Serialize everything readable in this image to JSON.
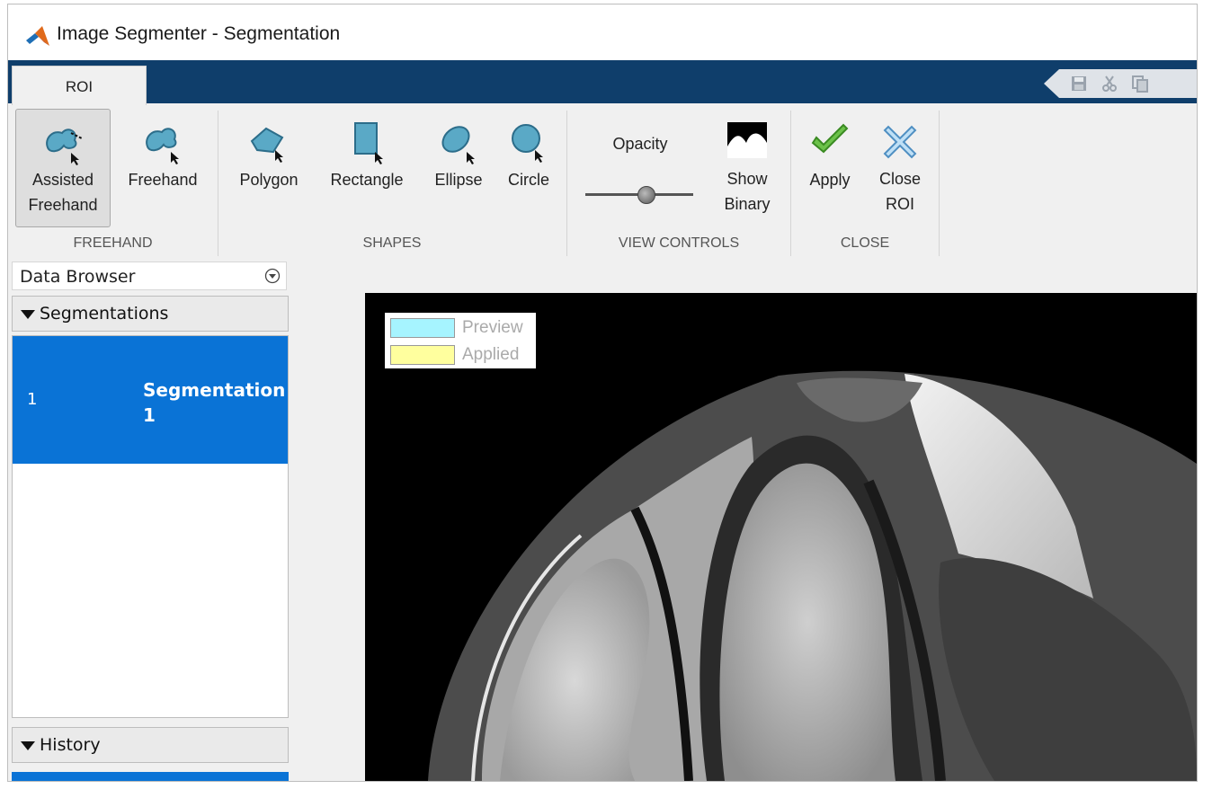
{
  "window": {
    "title": "Image Segmenter - Segmentation"
  },
  "tabs": [
    {
      "label": "ROI",
      "selected": true
    }
  ],
  "ribbon": {
    "groups": [
      {
        "label": "FREEHAND"
      },
      {
        "label": "SHAPES"
      },
      {
        "label": "VIEW CONTROLS"
      },
      {
        "label": "CLOSE"
      }
    ],
    "tools": {
      "assisted_freehand": {
        "line1": "Assisted",
        "line2": "Freehand",
        "active": true
      },
      "freehand": {
        "label": "Freehand"
      },
      "polygon": {
        "label": "Polygon"
      },
      "rectangle": {
        "label": "Rectangle"
      },
      "ellipse": {
        "label": "Ellipse"
      },
      "circle": {
        "label": "Circle"
      },
      "opacity": {
        "label": "Opacity"
      },
      "show_binary": {
        "line1": "Show",
        "line2": "Binary"
      },
      "apply": {
        "label": "Apply"
      },
      "close_roi": {
        "line1": "Close",
        "line2": "ROI"
      }
    }
  },
  "data_browser": {
    "title": "Data Browser",
    "segmentations_label": "Segmentations",
    "segmentations": [
      {
        "index": "1",
        "name": "Segmentation 1",
        "selected": true
      }
    ],
    "history_label": "History"
  },
  "legend": {
    "items": [
      {
        "label": "Preview",
        "color": "#a6f4ff"
      },
      {
        "label": "Applied",
        "color": "#ffff9e"
      }
    ]
  },
  "colors": {
    "tab_bar": "#0f3e6b",
    "selection": "#0a73d6",
    "shape_icon": "#5aa9c6"
  }
}
